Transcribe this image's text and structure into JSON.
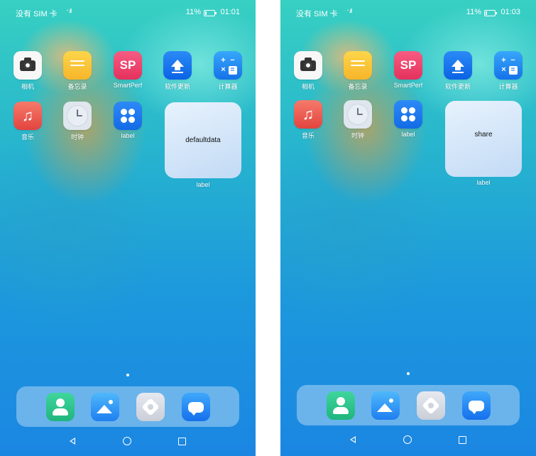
{
  "screens": [
    {
      "status": {
        "carrier": "没有 SIM 卡",
        "signal": "⁺.ıll",
        "battery_pct": "11%",
        "time": "01:01"
      },
      "apps": [
        {
          "label": "相机"
        },
        {
          "label": "备忘录"
        },
        {
          "label": "SmartPerf",
          "glyph": "SP"
        },
        {
          "label": "软件更新"
        },
        {
          "label": "计算器"
        },
        {
          "label": "音乐",
          "glyph": "♫"
        },
        {
          "label": "时钟"
        },
        {
          "label": "label"
        }
      ],
      "card": {
        "text": "defaultdata",
        "caption": "label"
      }
    },
    {
      "status": {
        "carrier": "没有 SIM 卡",
        "signal": "⁺.ıll",
        "battery_pct": "11%",
        "time": "01:03"
      },
      "apps": [
        {
          "label": "相机"
        },
        {
          "label": "备忘录"
        },
        {
          "label": "SmartPerf",
          "glyph": "SP"
        },
        {
          "label": "软件更新"
        },
        {
          "label": "计算器"
        },
        {
          "label": "音乐",
          "glyph": "♫"
        },
        {
          "label": "时钟"
        },
        {
          "label": "label"
        }
      ],
      "card": {
        "text": "share",
        "caption": "label"
      }
    }
  ],
  "calculator_glyphs": {
    "plus": "+",
    "minus": "−",
    "times": "×",
    "equals": "="
  },
  "icons": [
    "camera-icon",
    "memo-icon",
    "smartperf-icon",
    "software-update-icon",
    "calculator-icon",
    "music-icon",
    "clock-icon",
    "label-app-icon",
    "contacts-icon",
    "gallery-icon",
    "settings-icon",
    "messages-icon"
  ],
  "colors": {
    "wallpaper_top": "#37d0c2",
    "wallpaper_bottom": "#1b86e2",
    "card_bg": "#eef4ff"
  }
}
